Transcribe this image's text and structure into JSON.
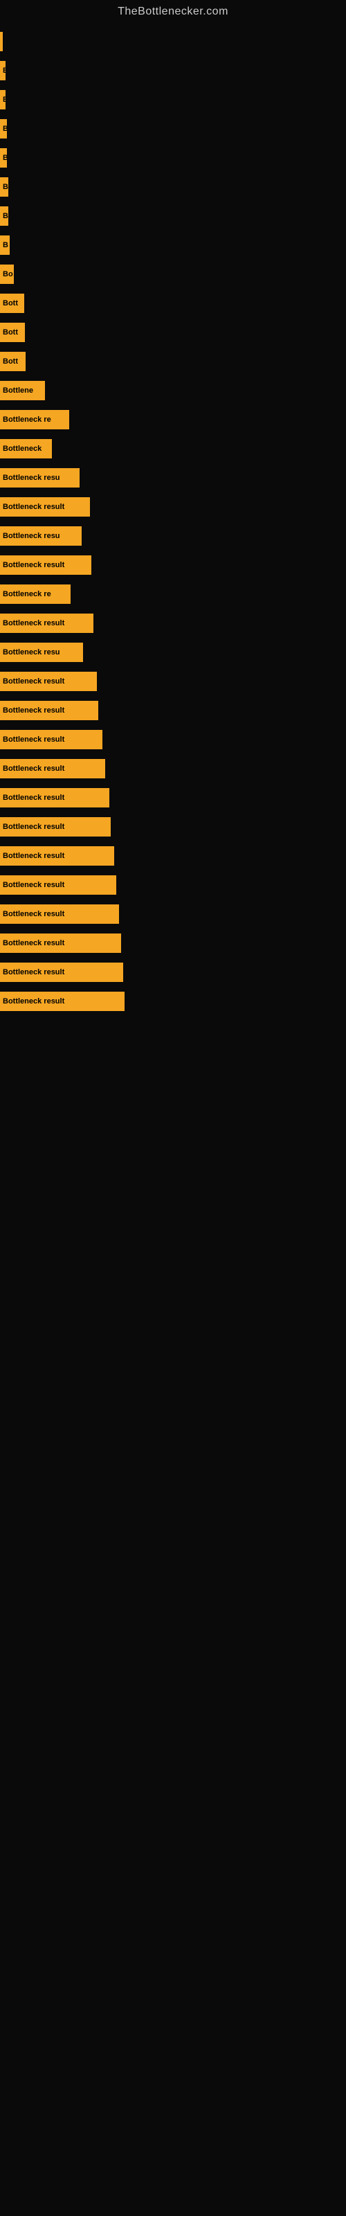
{
  "site": {
    "title": "TheBottlenecker.com"
  },
  "bars": [
    {
      "label": "",
      "width": 4
    },
    {
      "label": "B",
      "width": 8
    },
    {
      "label": "B",
      "width": 8
    },
    {
      "label": "B",
      "width": 10
    },
    {
      "label": "B",
      "width": 10
    },
    {
      "label": "B",
      "width": 12
    },
    {
      "label": "B",
      "width": 12
    },
    {
      "label": "B",
      "width": 14
    },
    {
      "label": "Bo",
      "width": 20
    },
    {
      "label": "Bott",
      "width": 35
    },
    {
      "label": "Bott",
      "width": 36
    },
    {
      "label": "Bott",
      "width": 37
    },
    {
      "label": "Bottlene",
      "width": 65
    },
    {
      "label": "Bottleneck re",
      "width": 100
    },
    {
      "label": "Bottleneck",
      "width": 75
    },
    {
      "label": "Bottleneck resu",
      "width": 115
    },
    {
      "label": "Bottleneck result",
      "width": 130
    },
    {
      "label": "Bottleneck resu",
      "width": 118
    },
    {
      "label": "Bottleneck result",
      "width": 132
    },
    {
      "label": "Bottleneck re",
      "width": 102
    },
    {
      "label": "Bottleneck result",
      "width": 135
    },
    {
      "label": "Bottleneck resu",
      "width": 120
    },
    {
      "label": "Bottleneck result",
      "width": 140
    },
    {
      "label": "Bottleneck result",
      "width": 142
    },
    {
      "label": "Bottleneck result",
      "width": 148
    },
    {
      "label": "Bottleneck result",
      "width": 152
    },
    {
      "label": "Bottleneck result",
      "width": 158
    },
    {
      "label": "Bottleneck result",
      "width": 160
    },
    {
      "label": "Bottleneck result",
      "width": 165
    },
    {
      "label": "Bottleneck result",
      "width": 168
    },
    {
      "label": "Bottleneck result",
      "width": 172
    },
    {
      "label": "Bottleneck result",
      "width": 175
    },
    {
      "label": "Bottleneck result",
      "width": 178
    },
    {
      "label": "Bottleneck result",
      "width": 180
    }
  ]
}
